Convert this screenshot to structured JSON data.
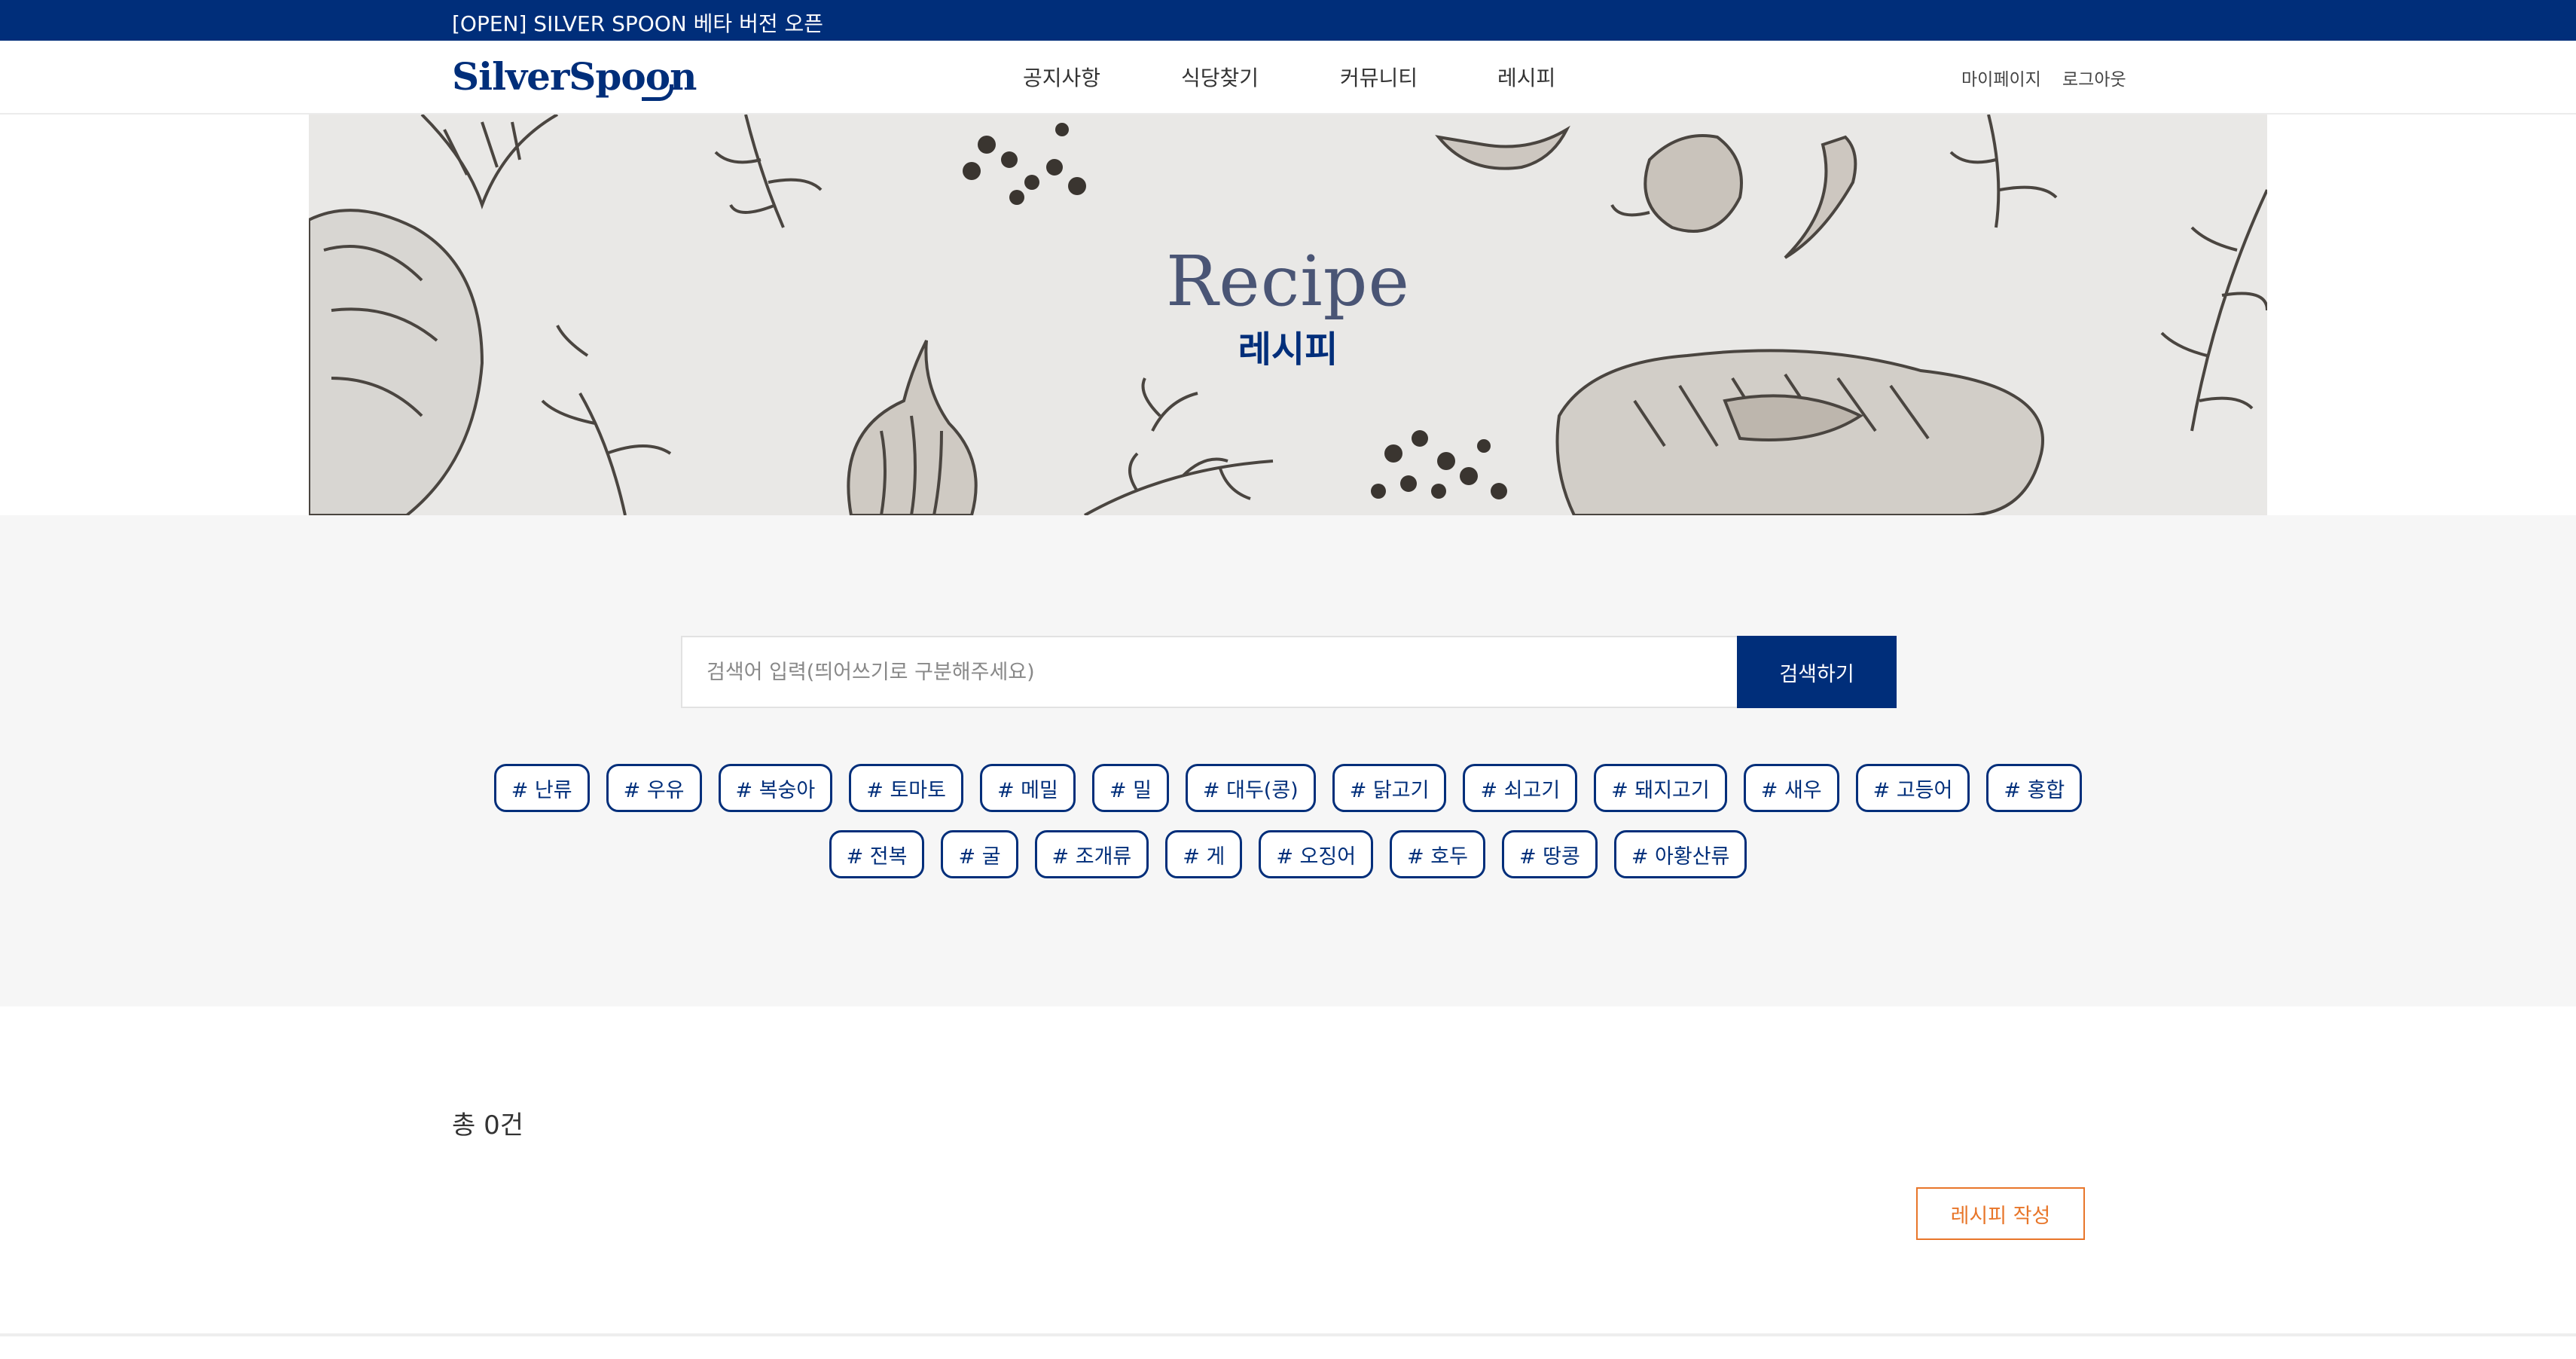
{
  "notice_bar": {
    "text": "[OPEN] SILVER SPOON 베타 버전 오픈"
  },
  "header": {
    "logo": "SilverSpoon",
    "nav": [
      "공지사항",
      "식당찾기",
      "커뮤니티",
      "레시피"
    ],
    "util": [
      "마이페이지",
      "로그아웃"
    ]
  },
  "banner": {
    "title_en": "Recipe",
    "title_ko": "레시피"
  },
  "search": {
    "placeholder": "검색어 입력(띄어쓰기로 구분해주세요)",
    "value": "",
    "button_label": "검색하기"
  },
  "tags_row1": [
    "# 난류",
    "# 우유",
    "# 복숭아",
    "# 토마토",
    "# 메밀",
    "# 밀",
    "# 대두(콩)",
    "# 닭고기",
    "# 쇠고기",
    "# 돼지고기",
    "# 새우",
    "# 고등어",
    "# 홍합"
  ],
  "tags_row2": [
    "# 전복",
    "# 굴",
    "# 조개류",
    "# 게",
    "# 오징어",
    "# 호두",
    "# 땅콩",
    "# 아황산류"
  ],
  "results": {
    "total_label": "총 0건",
    "write_button": "레시피 작성"
  },
  "colors": {
    "brand_navy": "#002e7a",
    "accent_orange": "#e8762a",
    "section_gray": "#f6f6f6"
  }
}
